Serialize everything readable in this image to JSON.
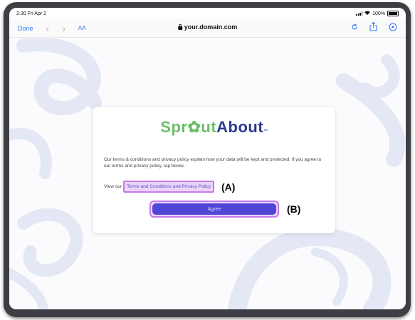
{
  "status_bar": {
    "time_date": "2:30  Fri Apr 2",
    "battery": "100%"
  },
  "browser": {
    "done_label": "Done",
    "back_icon": "chevron-left-icon",
    "forward_icon": "chevron-right-icon",
    "text_size_label": "AA",
    "address": "your.domain.com",
    "reload_icon": "reload-icon",
    "share_icon": "share-icon",
    "compass_icon": "compass-icon"
  },
  "card": {
    "logo_part1": "Spr",
    "logo_part2": "ut",
    "logo_part3": "About",
    "logo_tm": "™",
    "description": "Our terms & conditions and privacy policy explain how your data will be kept and protected. If you agree to our terms and privacy policy, tap below.",
    "view_prefix": "View our",
    "terms_link": "Terms and Conditions and Privacy Policy",
    "agree_label": "Agree"
  },
  "annotations": {
    "a": "(A)",
    "b": "(B)"
  },
  "colors": {
    "accent": "#3478f6",
    "button": "#5046d6",
    "highlight": "#c77ae6",
    "logo_green": "#6dbf6a",
    "logo_navy": "#2b3a8f"
  }
}
